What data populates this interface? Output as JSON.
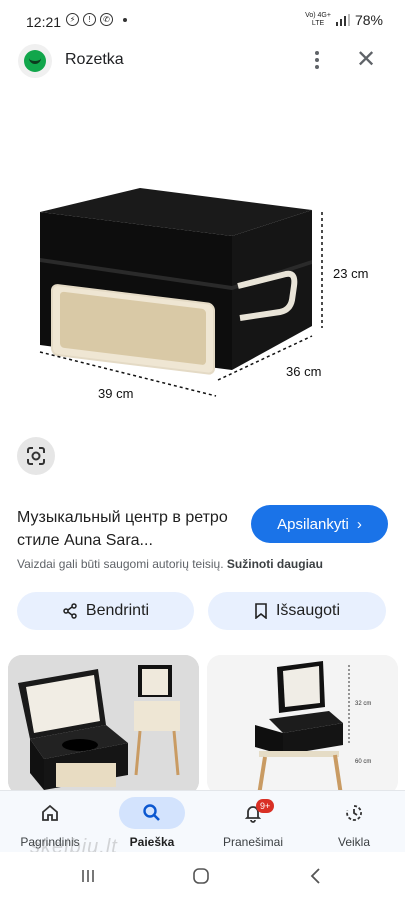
{
  "status_bar": {
    "time": "12:21",
    "network": "Vo) 4G+\nLTE",
    "battery": "78%"
  },
  "app": {
    "name": "Rozetka"
  },
  "image": {
    "dim_height": "23 cm",
    "dim_depth": "36 cm",
    "dim_width": "39 cm"
  },
  "product": {
    "title": "Музыкальный центр в ретро стиле Auna Sara...",
    "visit_label": "Apsilankyti",
    "copyright_text": "Vaizdai gali būti saugomi autorių teisių.",
    "learn_more": "Sužinoti daugiau"
  },
  "actions": {
    "share_label": "Bendrinti",
    "save_label": "Išsaugoti"
  },
  "thumb2_labels": {
    "upper": "32 cm",
    "lower": "60 cm"
  },
  "bottom_nav": {
    "items": [
      {
        "label": "Pagrindinis",
        "icon": "home-icon"
      },
      {
        "label": "Paieška",
        "icon": "search-icon",
        "active": true
      },
      {
        "label": "Pranešimai",
        "icon": "bell-icon",
        "badge": "9+"
      },
      {
        "label": "Veikla",
        "icon": "activity-icon"
      }
    ]
  },
  "watermark": "skelbiu.lt",
  "colors": {
    "accent": "#1a73e8",
    "pill_bg": "#e8f0fe",
    "badge": "#d93025"
  }
}
